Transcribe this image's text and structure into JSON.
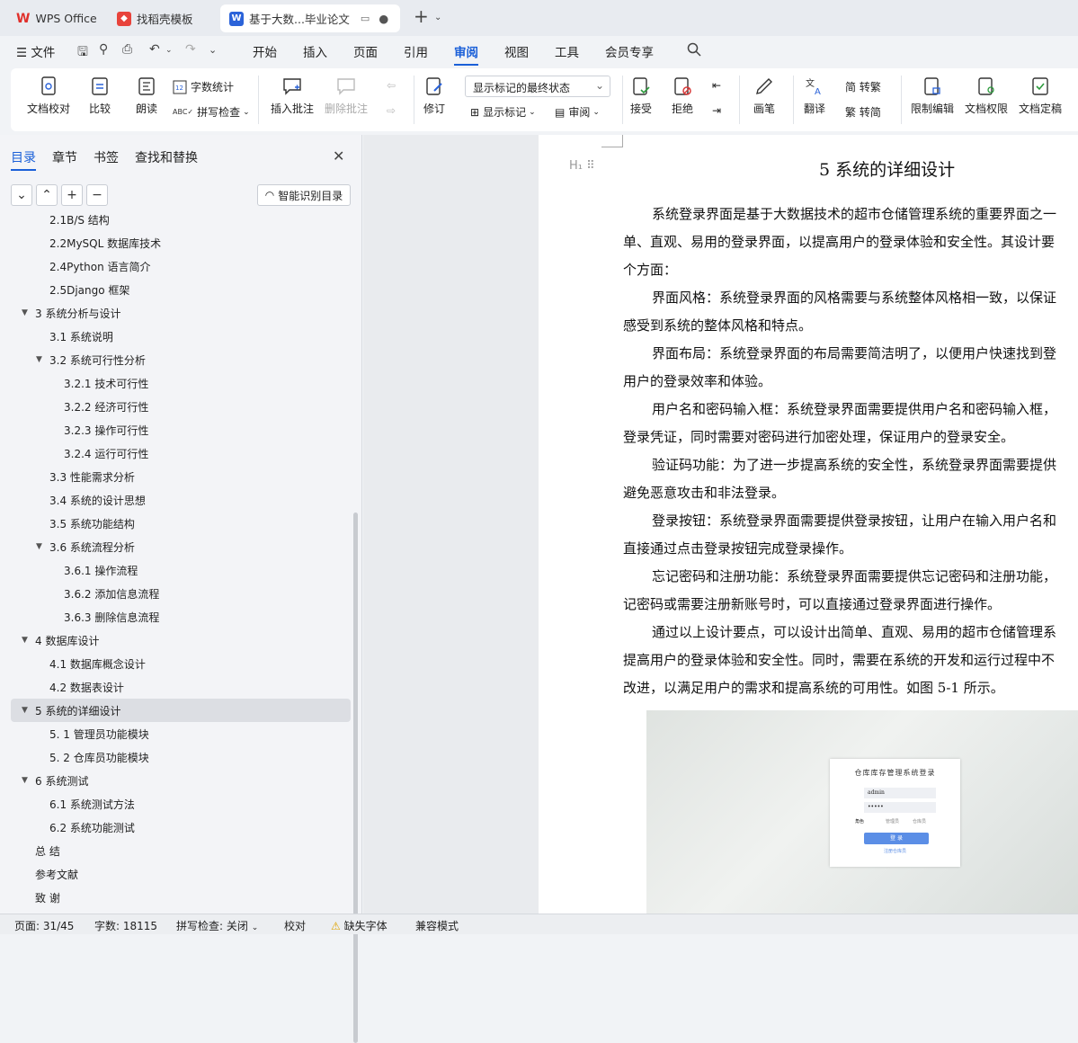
{
  "tabs": [
    {
      "label": "WPS Office"
    },
    {
      "label": "找稻壳模板"
    },
    {
      "label": "基于大数...毕业论文"
    }
  ],
  "menu": {
    "file": "文件",
    "items": [
      "开始",
      "插入",
      "页面",
      "引用",
      "审阅",
      "视图",
      "工具",
      "会员专享"
    ],
    "active": "审阅"
  },
  "ribbon": {
    "doc_check": "文档校对",
    "compare": "比较",
    "read_aloud": "朗读",
    "word_count": "字数统计",
    "spell_check": "拼写检查",
    "insert_comment": "插入批注",
    "delete_comment": "删除批注",
    "track": "修订",
    "display_select": "显示标记的最终状态",
    "show_markup": "显示标记",
    "review": "审阅",
    "accept": "接受",
    "reject": "拒绝",
    "pen": "画笔",
    "translate": "翻译",
    "to_trad": "简 转繁",
    "to_simp": "繁 转简",
    "restrict": "限制编辑",
    "permission": "文档权限",
    "finalize": "文档定稿"
  },
  "sidebar": {
    "tabs": [
      "目录",
      "章节",
      "书签",
      "查找和替换"
    ],
    "smart_button": "智能识别目录",
    "toc": [
      {
        "label": "2.1B/S 结构",
        "level": 2
      },
      {
        "label": "2.2MySQL 数据库技术",
        "level": 2
      },
      {
        "label": "2.4Python 语言简介",
        "level": 2
      },
      {
        "label": "2.5Django 框架",
        "level": 2
      },
      {
        "label": "3  系统分析与设计",
        "level": 1,
        "expanded": true
      },
      {
        "label": "3.1 系统说明",
        "level": 2
      },
      {
        "label": "3.2 系统可行性分析",
        "level": 2,
        "expanded": true
      },
      {
        "label": "3.2.1  技术可行性",
        "level": 3
      },
      {
        "label": "3.2.2  经济可行性",
        "level": 3
      },
      {
        "label": "3.2.3 操作可行性",
        "level": 3
      },
      {
        "label": "3.2.4 运行可行性",
        "level": 3
      },
      {
        "label": "3.3  性能需求分析",
        "level": 2
      },
      {
        "label": "3.4 系统的设计思想",
        "level": 2
      },
      {
        "label": "3.5 系统功能结构",
        "level": 2
      },
      {
        "label": "3.6 系统流程分析",
        "level": 2,
        "expanded": true
      },
      {
        "label": "3.6.1 操作流程",
        "level": 3
      },
      {
        "label": "3.6.2 添加信息流程",
        "level": 3
      },
      {
        "label": "3.6.3 删除信息流程",
        "level": 3
      },
      {
        "label": "4  数据库设计",
        "level": 1,
        "expanded": true
      },
      {
        "label": "4.1 数据库概念设计",
        "level": 2
      },
      {
        "label": "4.2 数据表设计",
        "level": 2
      },
      {
        "label": "5  系统的详细设计",
        "level": 1,
        "expanded": true,
        "selected": true
      },
      {
        "label": "5. 1 管理员功能模块",
        "level": 2
      },
      {
        "label": "5. 2 仓库员功能模块",
        "level": 2
      },
      {
        "label": "6  系统测试",
        "level": 1,
        "expanded": true
      },
      {
        "label": "6.1 系统测试方法",
        "level": 2
      },
      {
        "label": "6.2 系统功能测试",
        "level": 2
      },
      {
        "label": "总   结",
        "level": 1
      },
      {
        "label": "参考文献",
        "level": 1
      },
      {
        "label": "致   谢",
        "level": 1
      }
    ]
  },
  "document": {
    "heading": "5  系统的详细设计",
    "heading_marker": "H₁",
    "paragraphs": [
      "系统登录界面是基于大数据技术的超市仓储管理系统的重要界面之一",
      "单、直观、易用的登录界面，以提高用户的登录体验和安全性。其设计要",
      "个方面：",
      "界面风格：系统登录界面的风格需要与系统整体风格相一致，以保证",
      "感受到系统的整体风格和特点。",
      "界面布局：系统登录界面的布局需要简洁明了，以便用户快速找到登",
      "用户的登录效率和体验。",
      "用户名和密码输入框：系统登录界面需要提供用户名和密码输入框，",
      "登录凭证，同时需要对密码进行加密处理，保证用户的登录安全。",
      "验证码功能：为了进一步提高系统的安全性，系统登录界面需要提供",
      "避免恶意攻击和非法登录。",
      "登录按钮：系统登录界面需要提供登录按钮，让用户在输入用户名和",
      "直接通过点击登录按钮完成登录操作。",
      "忘记密码和注册功能：系统登录界面需要提供忘记密码和注册功能，",
      "记密码或需要注册新账号时，可以直接通过登录界面进行操作。",
      "通过以上设计要点，可以设计出简单、直观、易用的超市仓储管理系",
      "提高用户的登录体验和安全性。同时，需要在系统的开发和运行过程中不",
      "改进，以满足用户的需求和提高系统的可用性。如图 5-1 所示。"
    ],
    "indented": [
      0,
      3,
      5,
      7,
      9,
      11,
      13,
      15
    ],
    "figure": {
      "title": "仓库库存管理系统登录",
      "username": "admin",
      "password": "•••••",
      "role_label": "角色",
      "role_options": [
        "管理员",
        "仓库员"
      ],
      "login_button": "登 录",
      "register_link": "注册仓库员"
    }
  },
  "status": {
    "page": "页面: 31/45",
    "words": "字数: 18115",
    "spell": "拼写检查: 关闭",
    "proof": "校对",
    "missing_font": "缺失字体",
    "compat": "兼容模式"
  }
}
